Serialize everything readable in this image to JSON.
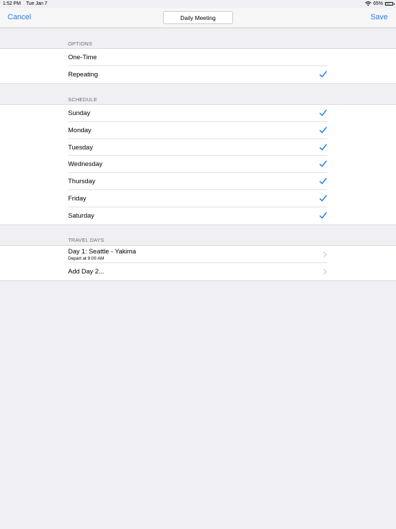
{
  "status_bar": {
    "time": "1:52 PM",
    "date": "Tue Jan 7",
    "battery": "65%",
    "battery_level": 0.65
  },
  "nav": {
    "cancel_label": "Cancel",
    "title_value": "Daily Meeting",
    "save_label": "Save"
  },
  "options": {
    "header": "OPTIONS",
    "items": [
      {
        "label": "One-Time",
        "checked": false
      },
      {
        "label": "Repeating",
        "checked": true
      }
    ]
  },
  "schedule": {
    "header": "SCHEDULE",
    "items": [
      {
        "label": "Sunday",
        "checked": true
      },
      {
        "label": "Monday",
        "checked": true
      },
      {
        "label": "Tuesday",
        "checked": true
      },
      {
        "label": "Wednesday",
        "checked": true
      },
      {
        "label": "Thursday",
        "checked": true
      },
      {
        "label": "Friday",
        "checked": true
      },
      {
        "label": "Saturday",
        "checked": true
      }
    ]
  },
  "travel_days": {
    "header": "TRAVEL DAYS",
    "items": [
      {
        "label": "Day 1: Seattle - Yakima",
        "detail": "Depart at 9:00 AM"
      },
      {
        "label": "Add Day 2..."
      }
    ]
  },
  "colors": {
    "accent": "#1a7cf0",
    "background": "#efeff4",
    "chevron": "#c7c7cc"
  }
}
